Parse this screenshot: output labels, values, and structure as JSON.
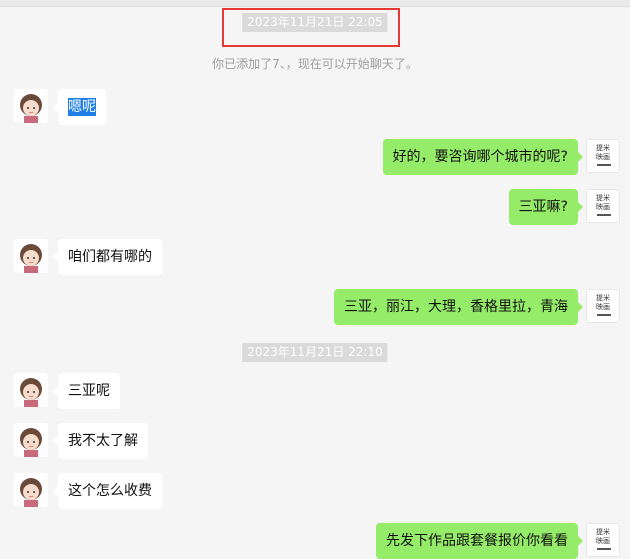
{
  "chat": {
    "timestamp1": "2023年11月21日 22:05",
    "system_notice": "你已添加了7、，现在可以开始聊天了。",
    "timestamp2": "2023年11月21日 22:10",
    "messages": [
      {
        "side": "left",
        "text": "嗯呢",
        "selected": true
      },
      {
        "side": "right",
        "text": "好的，要咨询哪个城市的呢?"
      },
      {
        "side": "right",
        "text": "三亚嘛?"
      },
      {
        "side": "left",
        "text": "咱们都有哪的"
      },
      {
        "side": "right",
        "text": "三亚，丽江，大理，香格里拉，青海"
      },
      {
        "side": "left",
        "text": "三亚呢"
      },
      {
        "side": "left",
        "text": "我不太了解"
      },
      {
        "side": "left",
        "text": "这个怎么收费"
      },
      {
        "side": "right",
        "text": "先发下作品跟套餐报价你看看"
      }
    ]
  },
  "avatars": {
    "contact": "girl-avatar",
    "self_logo_line1": "提米",
    "self_logo_line2": "映画"
  },
  "colors": {
    "outgoing_bubble": "#95ec69",
    "incoming_bubble": "#ffffff",
    "background": "#f5f5f5",
    "highlight_box": "#e53935",
    "selection": "#1f7fe6"
  }
}
